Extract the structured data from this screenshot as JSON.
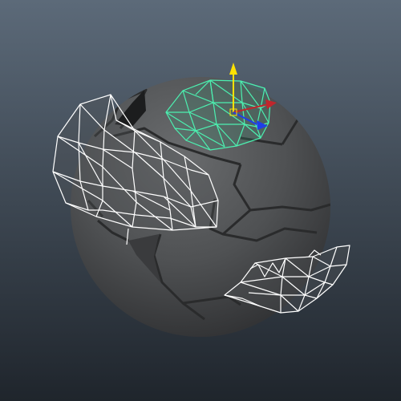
{
  "viewport": {
    "type": "3d-modeling-viewport",
    "background_top": "#5c6a79",
    "background_bottom": "#1f252c"
  },
  "scene": {
    "object": "fractured-sphere",
    "sphere_color": "#4f5153",
    "panel_seam_color": "#2a2b2c",
    "selected_wireframe_color": "#4cf0b0",
    "unselected_wireframe_color": "#ffffff",
    "gizmo": {
      "y_axis_color": "#ffe100",
      "x_axis_color": "#c0262c",
      "z_axis_color": "#1f3ee8"
    },
    "icons": [
      "move-gizmo-icon"
    ]
  }
}
